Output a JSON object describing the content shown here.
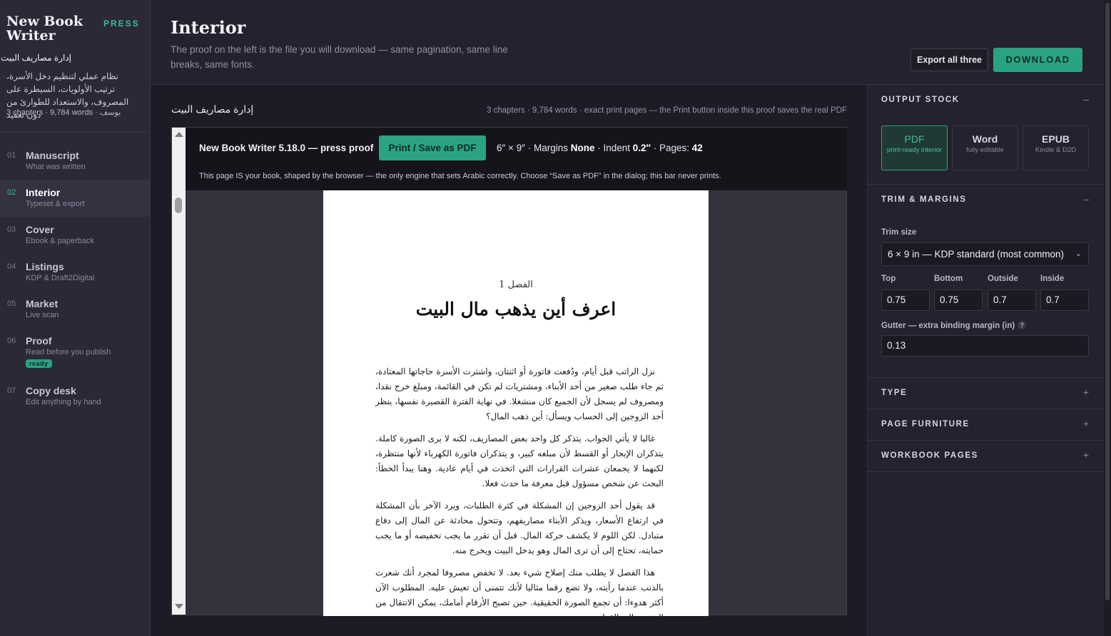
{
  "sidebar": {
    "brand": "New Book Writer",
    "press": "PRESS",
    "book_title": "إدارة مصاريف البيت",
    "book_desc": "نظام عملي لتنظيم دخل الأسرة، ترتيب الأولويات، السيطرة على المصروف، والاستعداد للطوارئ من دون تعقيد",
    "book_meta": "3 chapters · 9,784 words · يوسف",
    "nav": [
      {
        "num": "01",
        "label": "Manuscript",
        "sub": "What was written"
      },
      {
        "num": "02",
        "label": "Interior",
        "sub": "Typeset & export"
      },
      {
        "num": "03",
        "label": "Cover",
        "sub": "Ebook & paperback"
      },
      {
        "num": "04",
        "label": "Listings",
        "sub": "KDP & Draft2Digital"
      },
      {
        "num": "05",
        "label": "Market",
        "sub": "Live scan"
      },
      {
        "num": "06",
        "label": "Proof",
        "sub": "Read before you publish",
        "badge": "ready"
      },
      {
        "num": "07",
        "label": "Copy desk",
        "sub": "Edit anything by hand"
      }
    ]
  },
  "header": {
    "title": "Interior",
    "subtitle": "The proof on the left is the file you will download — same pagination, same line breaks, same fonts.",
    "export_label": "Export all three",
    "download_label": "DOWNLOAD"
  },
  "content": {
    "book_title": "إدارة مصاريف البيت",
    "meta": "3 chapters · 9,784 words · exact print pages — the Print button inside this proof saves the real PDF"
  },
  "proof": {
    "title": "New Book Writer 5.18.0 — press proof",
    "print_label": "Print / Save as PDF",
    "specs": {
      "size": "6″ × 9″ · Margins ",
      "margins": "None",
      "indent_label": " · Indent ",
      "indent": "0.2″",
      "pages_label": " · Pages: ",
      "pages": "42"
    },
    "note": "This page IS your book, shaped by the browser — the only engine that sets Arabic correctly. Choose “Save as PDF” in the dialog; this bar never prints.",
    "page": {
      "chapter_label": "الفصل 1",
      "chapter_title": "اعرف أين يذهب مال البيت",
      "paragraphs": [
        "نزل الراتب قبل أيام، ودُفعت فاتورة أو اثنتان، واشترت الأسرة حاجاتها المعتادة، ثم جاء طلب صغير من أحد الأبناء، ومشتريات لم تكن في القائمة، ومبلغ خرج نقدا، ومصروف لم يسجل لأن الجميع كان منشغلا. في نهاية الفترة القصيرة نفسها، ينظر أحد الزوجين إلى الحساب ويسأل: أين ذهب المال؟",
        "غالبا لا يأتي الجواب. يتذكر كل واحد بعض المصاريف، لكنه لا يرى الصورة كاملة. يتذكران الإيجار أو القسط لأن مبلغه كبير، و يتذكران فاتورة الكهرباء لأنها منتظرة، لكنهما لا يجمعان عشرات القرارات التي اتخذت في أيام عادية. وهنا يبدأ الخطأ: البحث عن شخص مسؤول قبل معرفة ما حدث فعلا.",
        "قد يقول أحد الزوجين إن المشكلة في كثرة الطلبات، ويرد الآخر بأن المشكلة في ارتفاع الأسعار، ويذكر الأبناء مصاريفهم، وتتحول محادثة عن المال إلى دفاع متبادل. لكن اللوم لا يكشف حركة المال. قبل أن تقرر ما يجب تخفيضه أو ما يجب حمايته، تحتاج إلى أن ترى المال وهو يدخل البيت ويخرج منه.",
        "هذا الفصل لا يطلب منك إصلاح شيء بعد. لا تخفض مصروفا لمجرد أنك شعرت بالذنب عندما رأيته، ولا تضع رقما مثاليا لأنك تتمنى أن تعيش عليه. المطلوب الآن أكثر هدوءا: أن تجمع الصورة الحقيقية. حين تصبح الأرقام أمامك، يمكن الانتقال من التخمين إلى القرار."
      ]
    }
  },
  "panel": {
    "output_stock": {
      "title": "OUTPUT STOCK",
      "toggle": "–",
      "options": [
        {
          "name": "PDF",
          "desc": "print-ready interior",
          "selected": true
        },
        {
          "name": "Word",
          "desc": "fully editable",
          "selected": false
        },
        {
          "name": "EPUB",
          "desc": "Kindle & D2D",
          "selected": false
        }
      ]
    },
    "trim": {
      "title": "TRIM & MARGINS",
      "toggle": "–",
      "trim_label": "Trim size",
      "trim_value": "6 × 9 in — KDP standard (most common)",
      "labels": [
        "Top",
        "Bottom",
        "Outside",
        "Inside"
      ],
      "values": [
        "0.75",
        "0.75",
        "0.7",
        "0.7"
      ],
      "gutter_label": "Gutter — extra binding margin (in)",
      "gutter_help": "?",
      "gutter_value": "0.13"
    },
    "type": {
      "title": "TYPE",
      "toggle": "+"
    },
    "furniture": {
      "title": "PAGE FURNITURE",
      "toggle": "+"
    },
    "workbook": {
      "title": "WORKBOOK PAGES",
      "toggle": "+"
    }
  }
}
